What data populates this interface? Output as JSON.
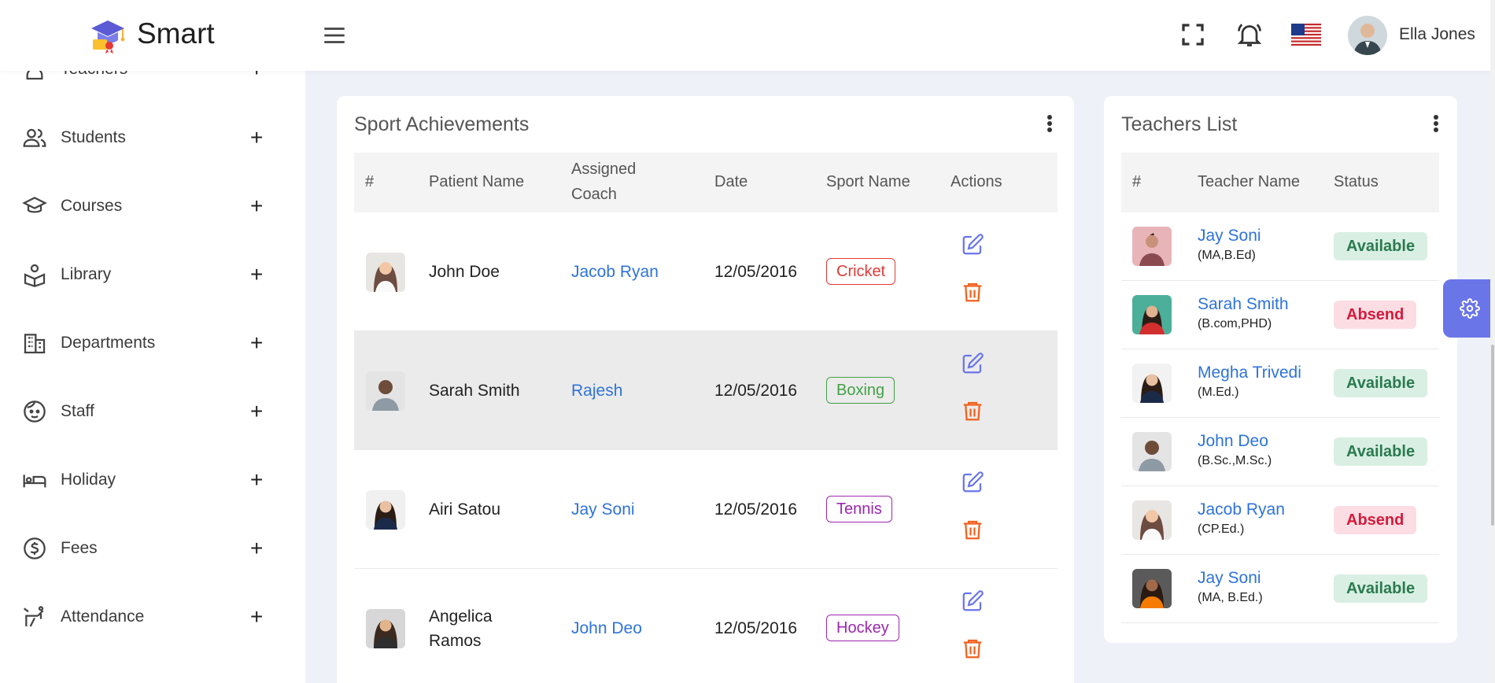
{
  "header": {
    "brand": "Smart",
    "user_name": "Ella Jones"
  },
  "sidebar": {
    "items": [
      {
        "label": "Teachers",
        "icon": "teacher-icon"
      },
      {
        "label": "Students",
        "icon": "students-icon"
      },
      {
        "label": "Courses",
        "icon": "courses-icon"
      },
      {
        "label": "Library",
        "icon": "library-icon"
      },
      {
        "label": "Departments",
        "icon": "departments-icon"
      },
      {
        "label": "Staff",
        "icon": "staff-icon"
      },
      {
        "label": "Holiday",
        "icon": "holiday-icon"
      },
      {
        "label": "Fees",
        "icon": "fees-icon"
      },
      {
        "label": "Attendance",
        "icon": "attendance-icon"
      }
    ],
    "plus": "+"
  },
  "sport": {
    "title": "Sport Achievements",
    "headers": {
      "num": "#",
      "name": "Patient Name",
      "coach_line1": "Assigned",
      "coach_line2": "Coach",
      "date": "Date",
      "sport": "Sport Name",
      "actions": "Actions"
    },
    "rows": [
      {
        "name": "John Doe",
        "coach": "Jacob Ryan",
        "date": "12/05/2016",
        "sport": "Cricket",
        "sport_color": "#e53935"
      },
      {
        "name": "Sarah Smith",
        "coach": "Rajesh",
        "date": "12/05/2016",
        "sport": "Boxing",
        "sport_color": "#43a047"
      },
      {
        "name": "Airi Satou",
        "coach": "Jay Soni",
        "date": "12/05/2016",
        "sport": "Tennis",
        "sport_color": "#9c27b0"
      },
      {
        "name_line1": "Angelica",
        "name_line2": "Ramos",
        "coach": "John Deo",
        "date": "12/05/2016",
        "sport": "Hockey",
        "sport_color": "#9c27b0"
      }
    ]
  },
  "teachers": {
    "title": "Teachers List",
    "headers": {
      "num": "#",
      "name": "Teacher Name",
      "status": "Status"
    },
    "rows": [
      {
        "name": "Jay Soni",
        "qual": "(MA,B.Ed)",
        "status": "Available"
      },
      {
        "name": "Sarah Smith",
        "qual": "(B.com,PHD)",
        "status": "Absend"
      },
      {
        "name": "Megha Trivedi",
        "qual": "(M.Ed.)",
        "status": "Available"
      },
      {
        "name": "John Deo",
        "qual": "(B.Sc.,M.Sc.)",
        "status": "Available"
      },
      {
        "name": "Jacob Ryan",
        "qual": "(CP.Ed.)",
        "status": "Absend"
      },
      {
        "name": "Jay Soni",
        "qual": "(MA, B.Ed.)",
        "status": "Available"
      }
    ]
  },
  "colors": {
    "accent": "#6a75e8",
    "link": "#2e73d9",
    "edit": "#6a75e8",
    "delete": "#f0621f"
  }
}
